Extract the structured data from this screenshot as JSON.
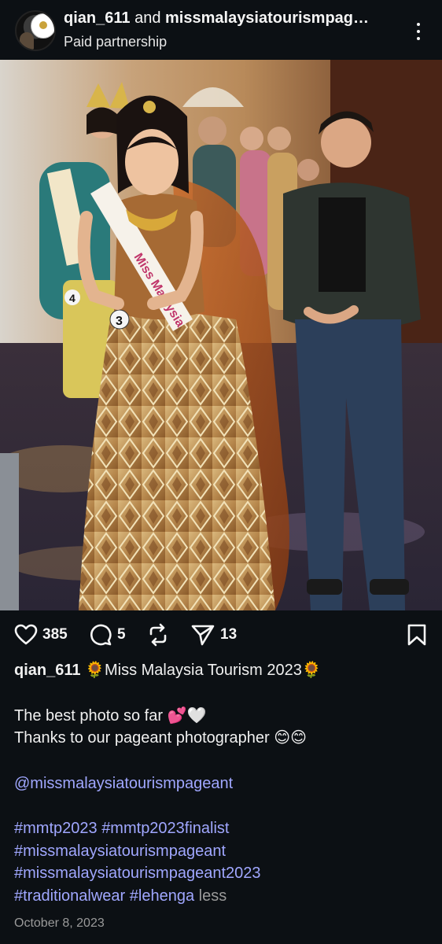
{
  "post": {
    "author_primary": "qian_611",
    "author_join": "and",
    "author_secondary": "missmalaysiatourismpag…",
    "subtitle": "Paid partnership",
    "sash_text": "Miss Malaysia",
    "badge_number": "3",
    "badge_number_back": "4"
  },
  "actions": {
    "likes": "385",
    "comments": "5",
    "shares": "13"
  },
  "caption": {
    "username": "qian_611",
    "title_emoji_left": "🌻",
    "title": "Miss Malaysia Tourism 2023",
    "title_emoji_right": "🌻",
    "line1": "The best photo so far 💕🤍",
    "line2": "Thanks to our pageant photographer 😊😊",
    "mention": "@missmalaysiatourismpageant",
    "hashtags": [
      "#mmtp2023",
      "#mmtp2023finalist",
      "#missmalaysiatourismpageant",
      "#missmalaysiatourismpageant2023",
      "#traditionalwear",
      "#lehenga"
    ],
    "less_label": "less"
  },
  "date": "October 8, 2023",
  "colors": {
    "background": "#0c1014",
    "link": "#a0a7ff",
    "muted": "#9a9a9a"
  }
}
